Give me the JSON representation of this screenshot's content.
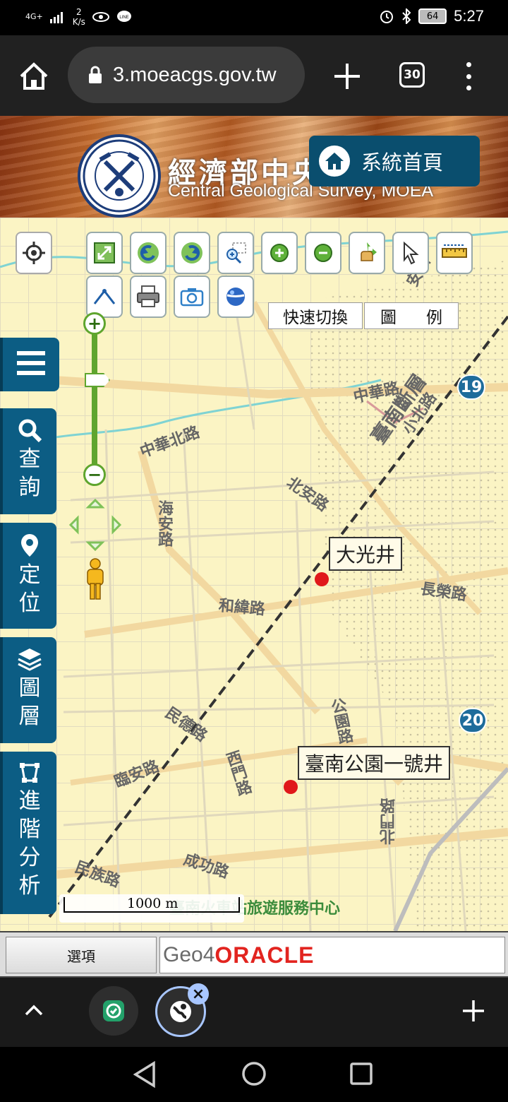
{
  "statusbar": {
    "network": "4G+",
    "speed_value": "2",
    "speed_unit": "K/s",
    "battery": "64",
    "time": "5:27"
  },
  "browser": {
    "url": "3.moeacgs.gov.tw",
    "tab_count": "30"
  },
  "header": {
    "title": "經濟部中央",
    "subtitle": "Central Geological Survey, MOEA",
    "home_button": "系統首頁"
  },
  "map": {
    "quick_switch": "快速切換",
    "legend_char1": "圖",
    "legend_char2": "例",
    "wells": [
      {
        "label": "大光井"
      },
      {
        "label": "臺南公園一號井"
      }
    ],
    "roads": [
      "中華北路",
      "中華路",
      "北安路",
      "海安路",
      "和緯路",
      "長榮路",
      "民德路",
      "公園路",
      "臨安路",
      "西門路",
      "成功路",
      "民族路",
      "北門路",
      "臺南斷層",
      "小北路",
      "安和",
      "臺南火車站旅遊服務中心"
    ],
    "highways": [
      "19",
      "20"
    ],
    "scale": "1000 m"
  },
  "sidebar": {
    "items": [
      {
        "label1": "查",
        "label2": "詢"
      },
      {
        "label1": "定",
        "label2": "位"
      },
      {
        "label1": "圖",
        "label2": "層"
      },
      {
        "label1": "進",
        "label2": "階",
        "label3": "分",
        "label4": "析"
      }
    ]
  },
  "controlbar": {
    "options": "選項",
    "geo4": "Geo4",
    "oracle": "ORACLE"
  },
  "colors": {
    "panel_blue": "#0c5d84",
    "map_bg": "#fbf4c4",
    "zoom_green": "#5fa52e",
    "well_red": "#e0181b"
  }
}
